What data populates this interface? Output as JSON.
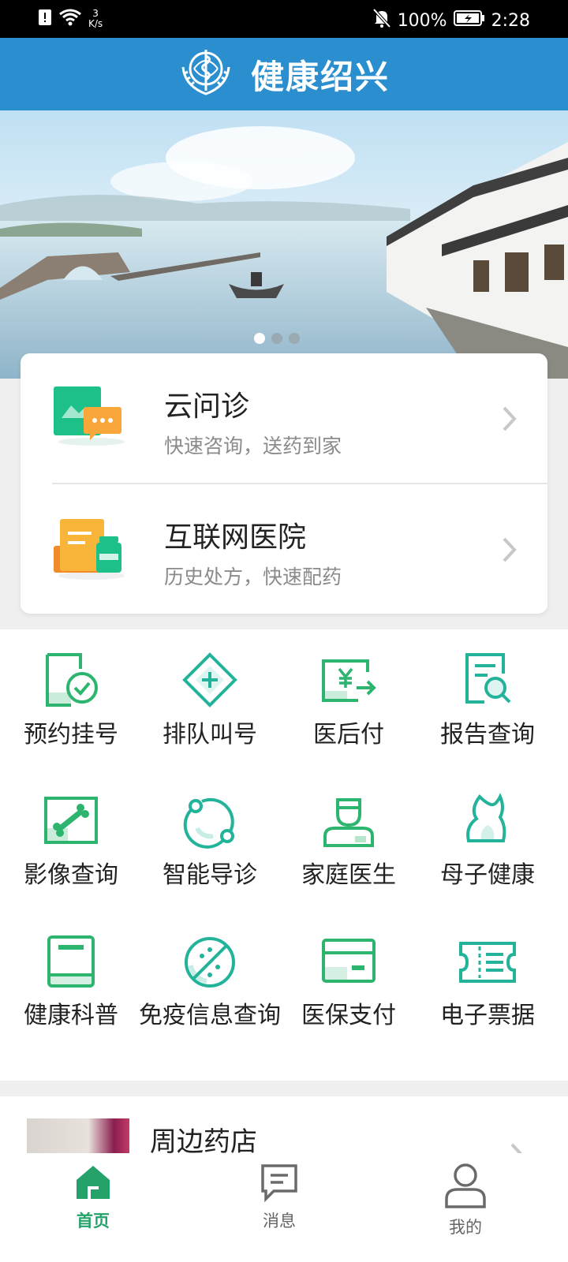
{
  "status_bar": {
    "speed_value": "3",
    "speed_unit": "K/s",
    "battery": "100%",
    "time": "2:28"
  },
  "header": {
    "title": "健康绍兴"
  },
  "banner": {
    "slides": 3,
    "active_index": 0
  },
  "services": [
    {
      "title": "云问诊",
      "subtitle": "快速咨询，送药到家"
    },
    {
      "title": "互联网医院",
      "subtitle": "历史处方，快速配药"
    }
  ],
  "grid": [
    {
      "label": "预约挂号"
    },
    {
      "label": "排队叫号"
    },
    {
      "label": "医后付"
    },
    {
      "label": "报告查询"
    },
    {
      "label": "影像查询"
    },
    {
      "label": "智能导诊"
    },
    {
      "label": "家庭医生"
    },
    {
      "label": "母子健康"
    },
    {
      "label": "健康科普"
    },
    {
      "label": "免疫信息查询"
    },
    {
      "label": "医保支付"
    },
    {
      "label": "电子票据"
    }
  ],
  "pharmacy": {
    "title": "周边药店"
  },
  "tabs": [
    {
      "label": "首页",
      "active": true
    },
    {
      "label": "消息",
      "active": false
    },
    {
      "label": "我的",
      "active": false
    }
  ],
  "colors": {
    "header_blue": "#2b8fcf",
    "accent_green": "#24a26a"
  }
}
